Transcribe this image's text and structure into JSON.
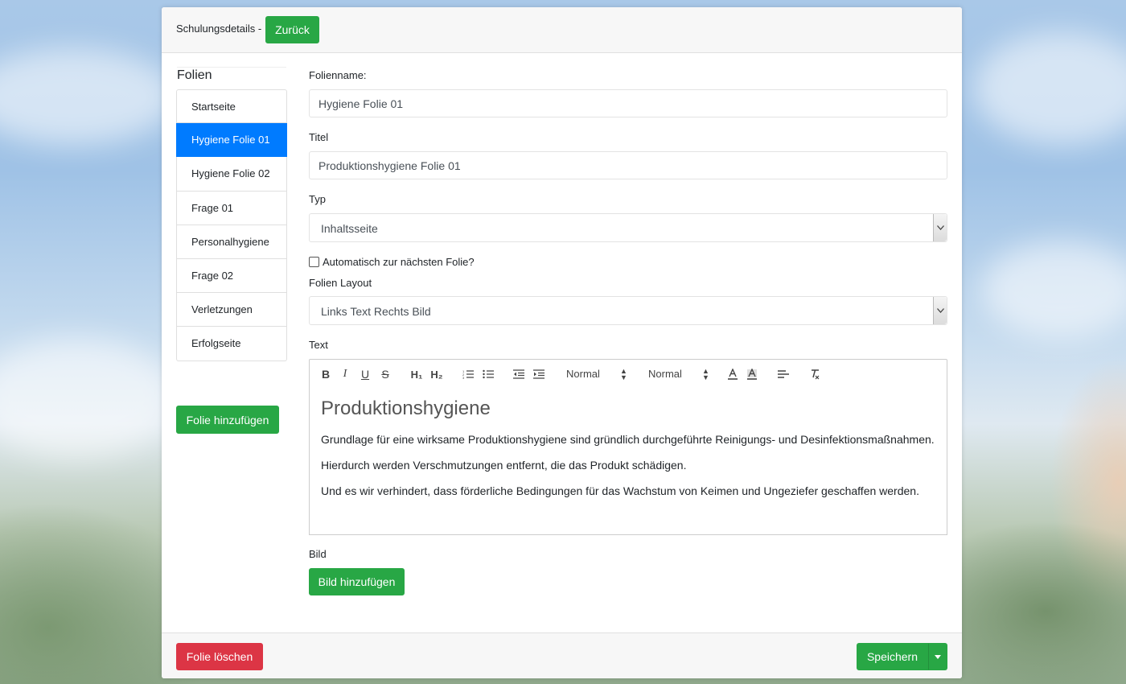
{
  "header": {
    "title": "Schulungsdetails -",
    "back_label": "Zurück"
  },
  "sidebar": {
    "heading": "Folien",
    "items": [
      {
        "label": "Startseite",
        "active": false
      },
      {
        "label": "Hygiene Folie 01",
        "active": true
      },
      {
        "label": "Hygiene Folie 02",
        "active": false
      },
      {
        "label": "Frage 01",
        "active": false
      },
      {
        "label": "Personalhygiene",
        "active": false
      },
      {
        "label": "Frage 02",
        "active": false
      },
      {
        "label": "Verletzungen",
        "active": false
      },
      {
        "label": "Erfolgseite",
        "active": false
      }
    ],
    "add_label": "Folie hinzufügen"
  },
  "form": {
    "slide_name_label": "Folienname:",
    "slide_name_value": "Hygiene Folie 01",
    "title_label": "Titel",
    "title_value": "Produktionshygiene Folie 01",
    "type_label": "Typ",
    "type_value": "Inhaltsseite",
    "auto_next_label": "Automatisch zur nächsten Folie?",
    "auto_next_checked": false,
    "layout_label": "Folien Layout",
    "layout_value": "Links Text Rechts Bild",
    "text_label": "Text",
    "image_label": "Bild",
    "add_image_label": "Bild hinzufügen"
  },
  "editor": {
    "toolbar": {
      "bold": "B",
      "italic": "I",
      "underline": "U",
      "strike": "S",
      "h1": "H₁",
      "h2": "H₂",
      "size_select": "Normal",
      "header_select": "Normal"
    },
    "heading": "Produktionshygiene",
    "paragraphs": [
      "Grundlage für eine wirksame Produktionshygiene sind gründlich durchgeführte Reinigungs- und Desinfektionsmaßnahmen.",
      "Hierdurch werden Verschmutzungen entfernt, die das Produkt schädigen.",
      "Und es wir verhindert, dass förderliche Bedingungen für das Wachstum von Keimen und Ungeziefer geschaffen werden."
    ]
  },
  "footer": {
    "delete_label": "Folie löschen",
    "save_label": "Speichern"
  },
  "colors": {
    "success": "#28a745",
    "danger": "#dc3545",
    "active": "#007bff"
  }
}
